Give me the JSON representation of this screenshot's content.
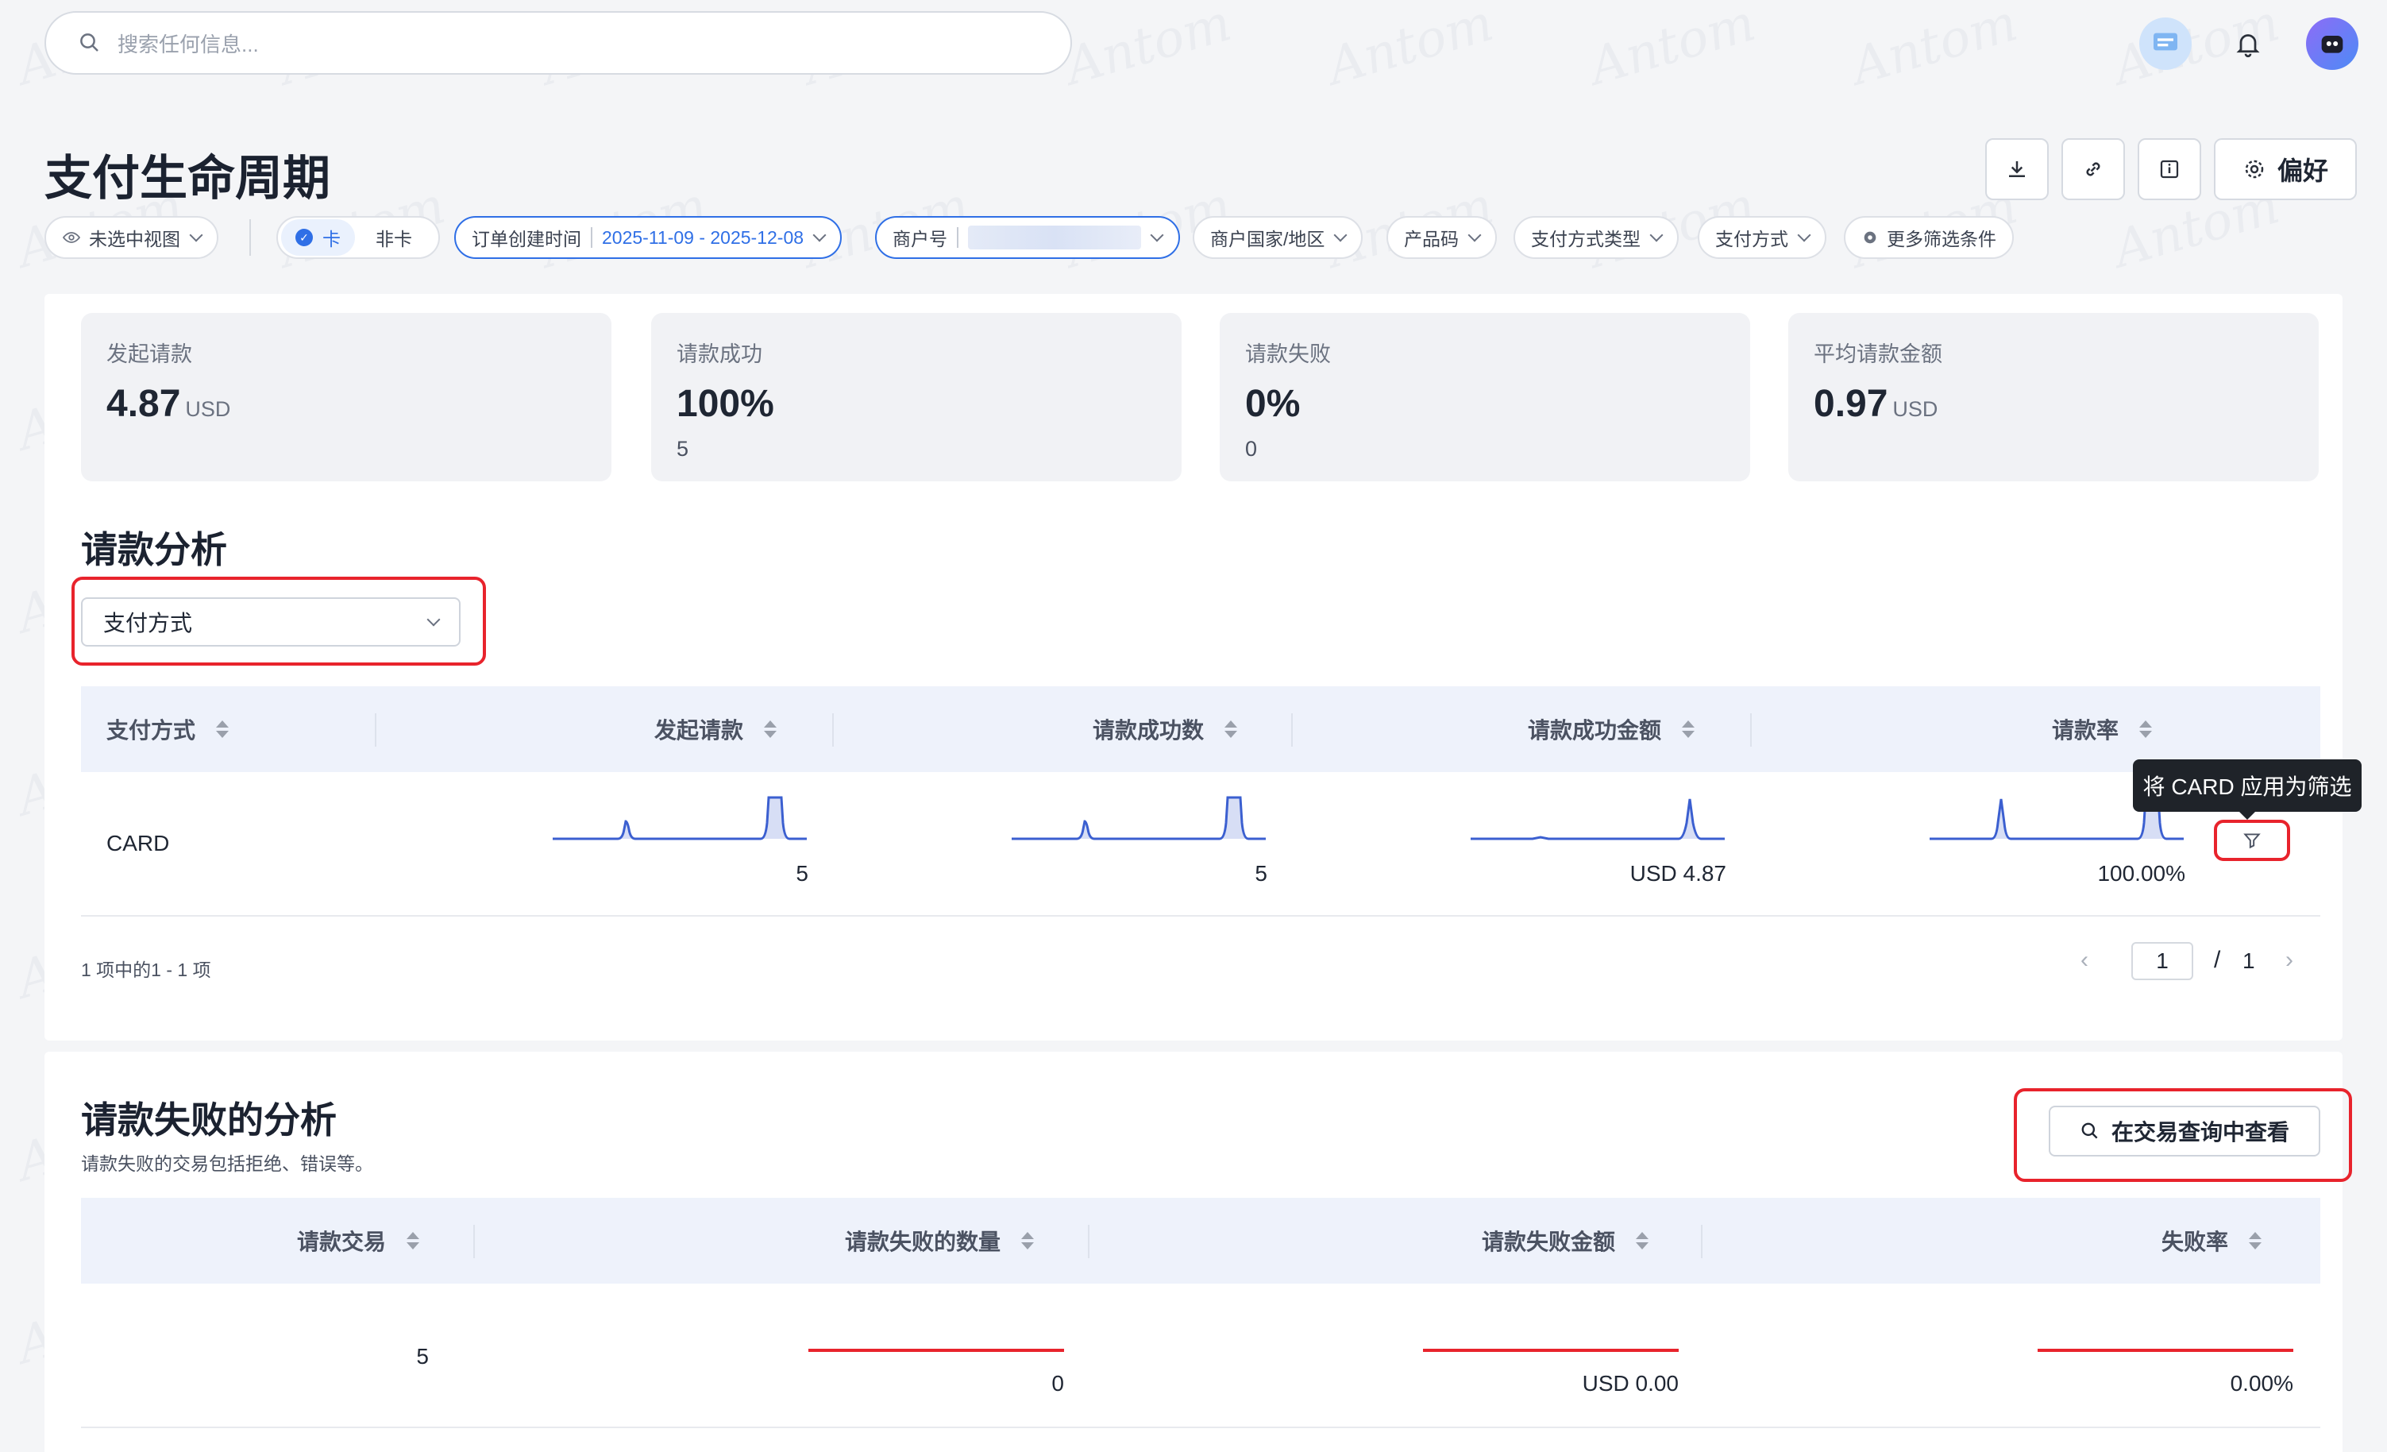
{
  "search": {
    "placeholder": "搜索任何信息..."
  },
  "watermark": "Antom",
  "page": {
    "title": "支付生命周期"
  },
  "toolbar": {
    "prefs_label": "偏好"
  },
  "filters": {
    "view_label": "未选中视图",
    "card_toggle": {
      "card": "卡",
      "non_card": "非卡"
    },
    "date": {
      "label": "订单创建时间",
      "value": "2025-11-09 - 2025-12-08"
    },
    "merchant": {
      "label": "商户号",
      "value": ""
    },
    "country": "商户国家/地区",
    "product": "产品码",
    "pm_type": "支付方式类型",
    "pm": "支付方式",
    "more": "更多筛选条件"
  },
  "kpis": [
    {
      "label": "发起请款",
      "value": "4.87",
      "unit": "USD",
      "sub": ""
    },
    {
      "label": "请款成功",
      "value": "100%",
      "unit": "",
      "sub": "5"
    },
    {
      "label": "请款失败",
      "value": "0%",
      "unit": "",
      "sub": "0"
    },
    {
      "label": "平均请款金额",
      "value": "0.97",
      "unit": "USD",
      "sub": ""
    }
  ],
  "analysis": {
    "title": "请款分析",
    "dimension": "支付方式",
    "columns": [
      "支付方式",
      "发起请款",
      "请款成功数",
      "请款成功金额",
      "请款率"
    ],
    "rows": [
      {
        "method": "CARD",
        "initiated": "5",
        "success_count": "5",
        "success_amount": "USD 4.87",
        "rate": "100.00%"
      }
    ],
    "tooltip": "将 CARD 应用为筛选",
    "range_text": "1 项中的1 - 1 项",
    "pager": {
      "current": "1",
      "sep": "/",
      "total": "1"
    }
  },
  "failure": {
    "title": "请款失败的分析",
    "subtitle": "请款失败的交易包括拒绝、错误等。",
    "view_button": "在交易查询中查看",
    "columns": [
      "请款交易",
      "请款失败的数量",
      "请款失败金额",
      "失败率"
    ],
    "row": {
      "transactions": "5",
      "fail_count": "0",
      "fail_amount": "USD 0.00",
      "fail_rate": "0.00%"
    }
  },
  "colors": {
    "accent": "#2f6fe6",
    "highlight": "#e8232c",
    "sparkline": "#3b5fd0"
  }
}
